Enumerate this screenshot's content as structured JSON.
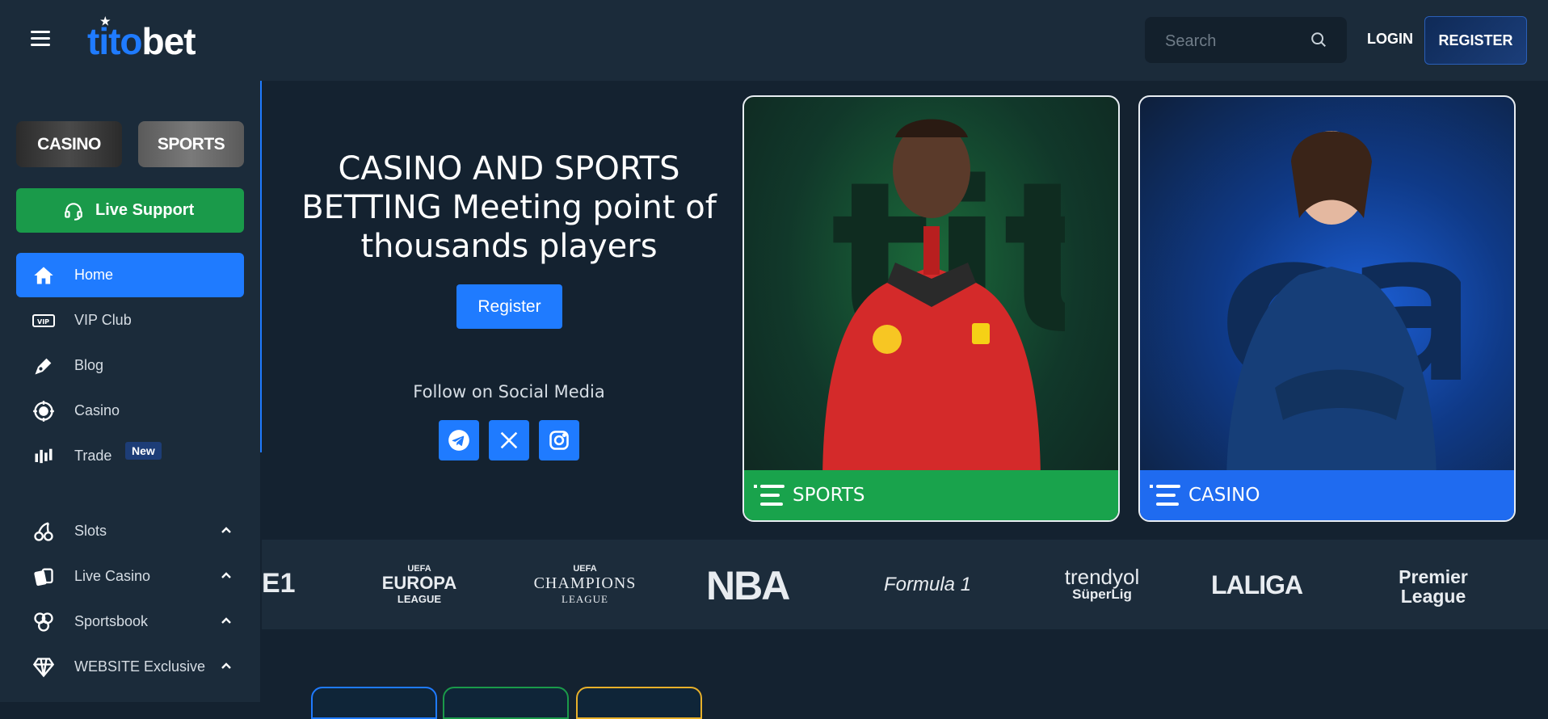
{
  "header": {
    "logo_prefix": "tito",
    "logo_suffix": "bet",
    "search_placeholder": "Search",
    "login_label": "LOGIN",
    "register_label": "REGISTER"
  },
  "sidebar": {
    "casino_label": "CASINO",
    "sports_label": "SPORTS",
    "live_support_label": "Live Support",
    "items": [
      {
        "label": "Home",
        "icon": "home-icon",
        "active": true
      },
      {
        "label": "VIP Club",
        "icon": "vip-icon"
      },
      {
        "label": "Blog",
        "icon": "pen-icon"
      },
      {
        "label": "Casino",
        "icon": "casino-chip-icon"
      },
      {
        "label": "Trade",
        "icon": "candlestick-icon",
        "badge": "New"
      },
      {
        "label": "Slots",
        "icon": "cherries-icon",
        "expandable": true
      },
      {
        "label": "Live Casino",
        "icon": "cards-icon",
        "expandable": true
      },
      {
        "label": "Sportsbook",
        "icon": "sports-balls-icon",
        "expandable": true
      },
      {
        "label": "WEBSITE Exclusive",
        "icon": "diamond-icon",
        "expandable": true
      }
    ]
  },
  "hero": {
    "headline_line1": "CASINO AND SPORTS",
    "headline_line2": "BETTING Meeting point of",
    "headline_line3": "thousands players",
    "register_label": "Register",
    "follow_label": "Follow on Social Media",
    "socials": [
      "telegram-icon",
      "x-icon",
      "instagram-icon"
    ]
  },
  "cards": {
    "sports_label": "SPORTS",
    "casino_label": "CASINO"
  },
  "leagues": [
    {
      "label": "E1"
    },
    {
      "top": "UEFA",
      "main": "EUROPA",
      "sub": "LEAGUE"
    },
    {
      "top": "UEFA",
      "main": "CHAMPIONS",
      "sub": "LEAGUE"
    },
    {
      "main": "NBA"
    },
    {
      "main": "Formula 1"
    },
    {
      "main": "trendyol",
      "sub": "SüperLig"
    },
    {
      "main": "LALIGA"
    },
    {
      "main": "Premier",
      "sub": "League"
    }
  ],
  "colors": {
    "accent": "#1f7bff",
    "support_green": "#1a9a4a",
    "sports_bar": "#19a34c",
    "casino_bar": "#1f6bf0",
    "bg": "#142230",
    "panel": "#1b2b3a"
  }
}
